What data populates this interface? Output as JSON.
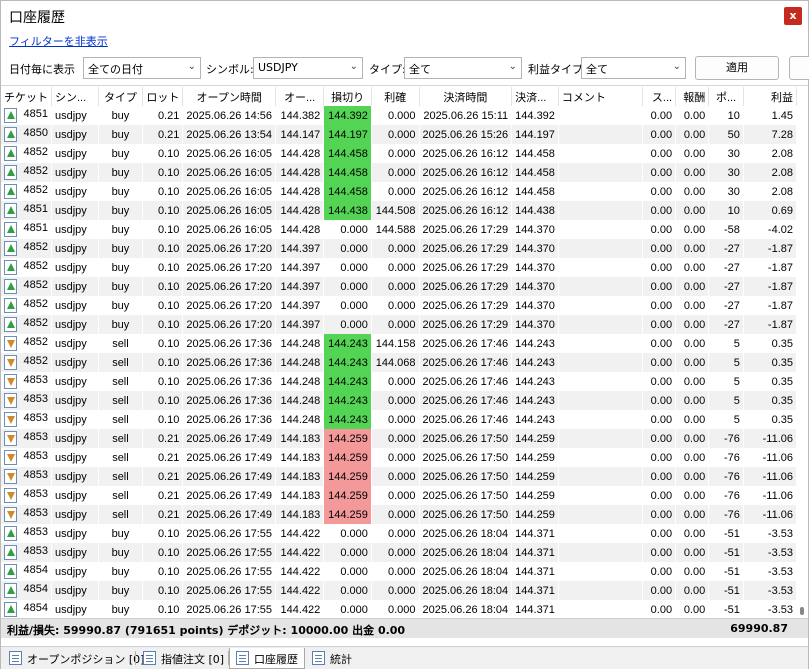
{
  "window": {
    "title": "口座履歴",
    "close_label": "x"
  },
  "filter_link": "フィルターを非表示",
  "filters": {
    "date_label": "日付毎に表示",
    "date_value": "全ての日付",
    "symbol_label": "シンボル:",
    "symbol_value": "USDJPY",
    "type_label": "タイプ:",
    "type_value": "全て",
    "profit_type_label": "利益タイプ",
    "profit_type_value": "全て",
    "apply_label": "適用"
  },
  "columns": [
    "チケット",
    "シン...",
    "タイプ",
    "ロット",
    "オープン時間",
    "オー...",
    "損切り",
    "利確",
    "決済時間",
    "決済...",
    "コメント",
    "ス...",
    "報酬",
    "ポ...",
    "利益"
  ],
  "rows": [
    {
      "dir": "up",
      "ticket": "4851",
      "symbol": "usdjpy",
      "type": "buy",
      "lot": "0.21",
      "open_time": "2025.06.26 14:56",
      "open_price": "144.382",
      "sl": "144.392",
      "tp": "0.000",
      "close_time": "2025.06.26 15:11",
      "close_price": "144.392",
      "comment": "",
      "swap": "0.00",
      "fee": "0.00",
      "points": "10",
      "profit": "1.45",
      "sl_color": "green"
    },
    {
      "dir": "up",
      "ticket": "4850",
      "symbol": "usdjpy",
      "type": "buy",
      "lot": "0.21",
      "open_time": "2025.06.26 13:54",
      "open_price": "144.147",
      "sl": "144.197",
      "tp": "0.000",
      "close_time": "2025.06.26 15:26",
      "close_price": "144.197",
      "comment": "",
      "swap": "0.00",
      "fee": "0.00",
      "points": "50",
      "profit": "7.28",
      "sl_color": "green"
    },
    {
      "dir": "up",
      "ticket": "4852",
      "symbol": "usdjpy",
      "type": "buy",
      "lot": "0.10",
      "open_time": "2025.06.26 16:05",
      "open_price": "144.428",
      "sl": "144.458",
      "tp": "0.000",
      "close_time": "2025.06.26 16:12",
      "close_price": "144.458",
      "comment": "",
      "swap": "0.00",
      "fee": "0.00",
      "points": "30",
      "profit": "2.08",
      "sl_color": "green"
    },
    {
      "dir": "up",
      "ticket": "4852",
      "symbol": "usdjpy",
      "type": "buy",
      "lot": "0.10",
      "open_time": "2025.06.26 16:05",
      "open_price": "144.428",
      "sl": "144.458",
      "tp": "0.000",
      "close_time": "2025.06.26 16:12",
      "close_price": "144.458",
      "comment": "",
      "swap": "0.00",
      "fee": "0.00",
      "points": "30",
      "profit": "2.08",
      "sl_color": "green"
    },
    {
      "dir": "up",
      "ticket": "4852",
      "symbol": "usdjpy",
      "type": "buy",
      "lot": "0.10",
      "open_time": "2025.06.26 16:05",
      "open_price": "144.428",
      "sl": "144.458",
      "tp": "0.000",
      "close_time": "2025.06.26 16:12",
      "close_price": "144.458",
      "comment": "",
      "swap": "0.00",
      "fee": "0.00",
      "points": "30",
      "profit": "2.08",
      "sl_color": "green"
    },
    {
      "dir": "up",
      "ticket": "4851",
      "symbol": "usdjpy",
      "type": "buy",
      "lot": "0.10",
      "open_time": "2025.06.26 16:05",
      "open_price": "144.428",
      "sl": "144.438",
      "tp": "144.508",
      "close_time": "2025.06.26 16:12",
      "close_price": "144.438",
      "comment": "",
      "swap": "0.00",
      "fee": "0.00",
      "points": "10",
      "profit": "0.69",
      "sl_color": "green"
    },
    {
      "dir": "up",
      "ticket": "4851",
      "symbol": "usdjpy",
      "type": "buy",
      "lot": "0.10",
      "open_time": "2025.06.26 16:05",
      "open_price": "144.428",
      "sl": "0.000",
      "tp": "144.588",
      "close_time": "2025.06.26 17:29",
      "close_price": "144.370",
      "comment": "",
      "swap": "0.00",
      "fee": "0.00",
      "points": "-58",
      "profit": "-4.02",
      "sl_color": ""
    },
    {
      "dir": "up",
      "ticket": "4852",
      "symbol": "usdjpy",
      "type": "buy",
      "lot": "0.10",
      "open_time": "2025.06.26 17:20",
      "open_price": "144.397",
      "sl": "0.000",
      "tp": "0.000",
      "close_time": "2025.06.26 17:29",
      "close_price": "144.370",
      "comment": "",
      "swap": "0.00",
      "fee": "0.00",
      "points": "-27",
      "profit": "-1.87",
      "sl_color": ""
    },
    {
      "dir": "up",
      "ticket": "4852",
      "symbol": "usdjpy",
      "type": "buy",
      "lot": "0.10",
      "open_time": "2025.06.26 17:20",
      "open_price": "144.397",
      "sl": "0.000",
      "tp": "0.000",
      "close_time": "2025.06.26 17:29",
      "close_price": "144.370",
      "comment": "",
      "swap": "0.00",
      "fee": "0.00",
      "points": "-27",
      "profit": "-1.87",
      "sl_color": ""
    },
    {
      "dir": "up",
      "ticket": "4852",
      "symbol": "usdjpy",
      "type": "buy",
      "lot": "0.10",
      "open_time": "2025.06.26 17:20",
      "open_price": "144.397",
      "sl": "0.000",
      "tp": "0.000",
      "close_time": "2025.06.26 17:29",
      "close_price": "144.370",
      "comment": "",
      "swap": "0.00",
      "fee": "0.00",
      "points": "-27",
      "profit": "-1.87",
      "sl_color": ""
    },
    {
      "dir": "up",
      "ticket": "4852",
      "symbol": "usdjpy",
      "type": "buy",
      "lot": "0.10",
      "open_time": "2025.06.26 17:20",
      "open_price": "144.397",
      "sl": "0.000",
      "tp": "0.000",
      "close_time": "2025.06.26 17:29",
      "close_price": "144.370",
      "comment": "",
      "swap": "0.00",
      "fee": "0.00",
      "points": "-27",
      "profit": "-1.87",
      "sl_color": ""
    },
    {
      "dir": "up",
      "ticket": "4852",
      "symbol": "usdjpy",
      "type": "buy",
      "lot": "0.10",
      "open_time": "2025.06.26 17:20",
      "open_price": "144.397",
      "sl": "0.000",
      "tp": "0.000",
      "close_time": "2025.06.26 17:29",
      "close_price": "144.370",
      "comment": "",
      "swap": "0.00",
      "fee": "0.00",
      "points": "-27",
      "profit": "-1.87",
      "sl_color": ""
    },
    {
      "dir": "down",
      "ticket": "4852",
      "symbol": "usdjpy",
      "type": "sell",
      "lot": "0.10",
      "open_time": "2025.06.26 17:36",
      "open_price": "144.248",
      "sl": "144.243",
      "tp": "144.158",
      "close_time": "2025.06.26 17:46",
      "close_price": "144.243",
      "comment": "",
      "swap": "0.00",
      "fee": "0.00",
      "points": "5",
      "profit": "0.35",
      "sl_color": "green"
    },
    {
      "dir": "down",
      "ticket": "4852",
      "symbol": "usdjpy",
      "type": "sell",
      "lot": "0.10",
      "open_time": "2025.06.26 17:36",
      "open_price": "144.248",
      "sl": "144.243",
      "tp": "144.068",
      "close_time": "2025.06.26 17:46",
      "close_price": "144.243",
      "comment": "",
      "swap": "0.00",
      "fee": "0.00",
      "points": "5",
      "profit": "0.35",
      "sl_color": "green"
    },
    {
      "dir": "down",
      "ticket": "4853",
      "symbol": "usdjpy",
      "type": "sell",
      "lot": "0.10",
      "open_time": "2025.06.26 17:36",
      "open_price": "144.248",
      "sl": "144.243",
      "tp": "0.000",
      "close_time": "2025.06.26 17:46",
      "close_price": "144.243",
      "comment": "",
      "swap": "0.00",
      "fee": "0.00",
      "points": "5",
      "profit": "0.35",
      "sl_color": "green"
    },
    {
      "dir": "down",
      "ticket": "4853",
      "symbol": "usdjpy",
      "type": "sell",
      "lot": "0.10",
      "open_time": "2025.06.26 17:36",
      "open_price": "144.248",
      "sl": "144.243",
      "tp": "0.000",
      "close_time": "2025.06.26 17:46",
      "close_price": "144.243",
      "comment": "",
      "swap": "0.00",
      "fee": "0.00",
      "points": "5",
      "profit": "0.35",
      "sl_color": "green"
    },
    {
      "dir": "down",
      "ticket": "4853",
      "symbol": "usdjpy",
      "type": "sell",
      "lot": "0.10",
      "open_time": "2025.06.26 17:36",
      "open_price": "144.248",
      "sl": "144.243",
      "tp": "0.000",
      "close_time": "2025.06.26 17:46",
      "close_price": "144.243",
      "comment": "",
      "swap": "0.00",
      "fee": "0.00",
      "points": "5",
      "profit": "0.35",
      "sl_color": "green"
    },
    {
      "dir": "down",
      "ticket": "4853",
      "symbol": "usdjpy",
      "type": "sell",
      "lot": "0.21",
      "open_time": "2025.06.26 17:49",
      "open_price": "144.183",
      "sl": "144.259",
      "tp": "0.000",
      "close_time": "2025.06.26 17:50",
      "close_price": "144.259",
      "comment": "",
      "swap": "0.00",
      "fee": "0.00",
      "points": "-76",
      "profit": "-11.06",
      "sl_color": "red"
    },
    {
      "dir": "down",
      "ticket": "4853",
      "symbol": "usdjpy",
      "type": "sell",
      "lot": "0.21",
      "open_time": "2025.06.26 17:49",
      "open_price": "144.183",
      "sl": "144.259",
      "tp": "0.000",
      "close_time": "2025.06.26 17:50",
      "close_price": "144.259",
      "comment": "",
      "swap": "0.00",
      "fee": "0.00",
      "points": "-76",
      "profit": "-11.06",
      "sl_color": "red"
    },
    {
      "dir": "down",
      "ticket": "4853",
      "symbol": "usdjpy",
      "type": "sell",
      "lot": "0.21",
      "open_time": "2025.06.26 17:49",
      "open_price": "144.183",
      "sl": "144.259",
      "tp": "0.000",
      "close_time": "2025.06.26 17:50",
      "close_price": "144.259",
      "comment": "",
      "swap": "0.00",
      "fee": "0.00",
      "points": "-76",
      "profit": "-11.06",
      "sl_color": "red"
    },
    {
      "dir": "down",
      "ticket": "4853",
      "symbol": "usdjpy",
      "type": "sell",
      "lot": "0.21",
      "open_time": "2025.06.26 17:49",
      "open_price": "144.183",
      "sl": "144.259",
      "tp": "0.000",
      "close_time": "2025.06.26 17:50",
      "close_price": "144.259",
      "comment": "",
      "swap": "0.00",
      "fee": "0.00",
      "points": "-76",
      "profit": "-11.06",
      "sl_color": "red"
    },
    {
      "dir": "down",
      "ticket": "4853",
      "symbol": "usdjpy",
      "type": "sell",
      "lot": "0.21",
      "open_time": "2025.06.26 17:49",
      "open_price": "144.183",
      "sl": "144.259",
      "tp": "0.000",
      "close_time": "2025.06.26 17:50",
      "close_price": "144.259",
      "comment": "",
      "swap": "0.00",
      "fee": "0.00",
      "points": "-76",
      "profit": "-11.06",
      "sl_color": "red"
    },
    {
      "dir": "up",
      "ticket": "4853",
      "symbol": "usdjpy",
      "type": "buy",
      "lot": "0.10",
      "open_time": "2025.06.26 17:55",
      "open_price": "144.422",
      "sl": "0.000",
      "tp": "0.000",
      "close_time": "2025.06.26 18:04",
      "close_price": "144.371",
      "comment": "",
      "swap": "0.00",
      "fee": "0.00",
      "points": "-51",
      "profit": "-3.53",
      "sl_color": ""
    },
    {
      "dir": "up",
      "ticket": "4853",
      "symbol": "usdjpy",
      "type": "buy",
      "lot": "0.10",
      "open_time": "2025.06.26 17:55",
      "open_price": "144.422",
      "sl": "0.000",
      "tp": "0.000",
      "close_time": "2025.06.26 18:04",
      "close_price": "144.371",
      "comment": "",
      "swap": "0.00",
      "fee": "0.00",
      "points": "-51",
      "profit": "-3.53",
      "sl_color": ""
    },
    {
      "dir": "up",
      "ticket": "4854",
      "symbol": "usdjpy",
      "type": "buy",
      "lot": "0.10",
      "open_time": "2025.06.26 17:55",
      "open_price": "144.422",
      "sl": "0.000",
      "tp": "0.000",
      "close_time": "2025.06.26 18:04",
      "close_price": "144.371",
      "comment": "",
      "swap": "0.00",
      "fee": "0.00",
      "points": "-51",
      "profit": "-3.53",
      "sl_color": ""
    },
    {
      "dir": "up",
      "ticket": "4854",
      "symbol": "usdjpy",
      "type": "buy",
      "lot": "0.10",
      "open_time": "2025.06.26 17:55",
      "open_price": "144.422",
      "sl": "0.000",
      "tp": "0.000",
      "close_time": "2025.06.26 18:04",
      "close_price": "144.371",
      "comment": "",
      "swap": "0.00",
      "fee": "0.00",
      "points": "-51",
      "profit": "-3.53",
      "sl_color": ""
    },
    {
      "dir": "up",
      "ticket": "4854",
      "symbol": "usdjpy",
      "type": "buy",
      "lot": "0.10",
      "open_time": "2025.06.26 17:55",
      "open_price": "144.422",
      "sl": "0.000",
      "tp": "0.000",
      "close_time": "2025.06.26 18:04",
      "close_price": "144.371",
      "comment": "",
      "swap": "0.00",
      "fee": "0.00",
      "points": "-51",
      "profit": "-3.53",
      "sl_color": ""
    }
  ],
  "summary": {
    "text": "利益/損失: 59990.87 (791651 points) デポジット: 10000.00 出金 0.00",
    "total": "69990.87"
  },
  "tabs": [
    {
      "label": "オープンポジション [0]",
      "active": false
    },
    {
      "label": "指値注文 [0]",
      "active": false
    },
    {
      "label": "口座履歴",
      "active": true
    },
    {
      "label": "統計",
      "active": false
    }
  ],
  "colors": {
    "sl_hit_green": "#54d454",
    "sl_hit_red": "#f39999",
    "close": "#c42b1c"
  },
  "icons": {
    "buy": "arrow-up-icon",
    "sell": "arrow-down-icon",
    "tab": "document-icon"
  }
}
